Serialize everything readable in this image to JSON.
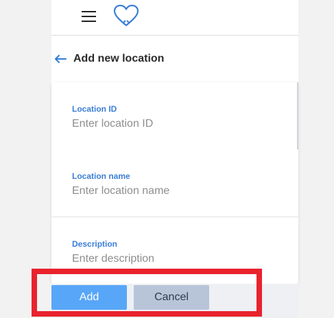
{
  "header": {
    "menu_icon": "hamburger-menu-icon",
    "logo_icon": "heart-icon"
  },
  "page": {
    "title": "Add new location",
    "back_icon": "back-arrow-icon"
  },
  "form": {
    "fields": [
      {
        "label": "Location ID",
        "placeholder": "Enter location ID",
        "value": ""
      },
      {
        "label": "Location name",
        "placeholder": "Enter location name",
        "value": ""
      },
      {
        "label": "Description",
        "placeholder": "Enter description",
        "value": ""
      }
    ]
  },
  "actions": {
    "add_label": "Add",
    "cancel_label": "Cancel"
  },
  "colors": {
    "accent": "#3b7ed8",
    "primary_button": "#58a6f8",
    "secondary_button": "#b8c4d8",
    "highlight": "#e8232d"
  }
}
